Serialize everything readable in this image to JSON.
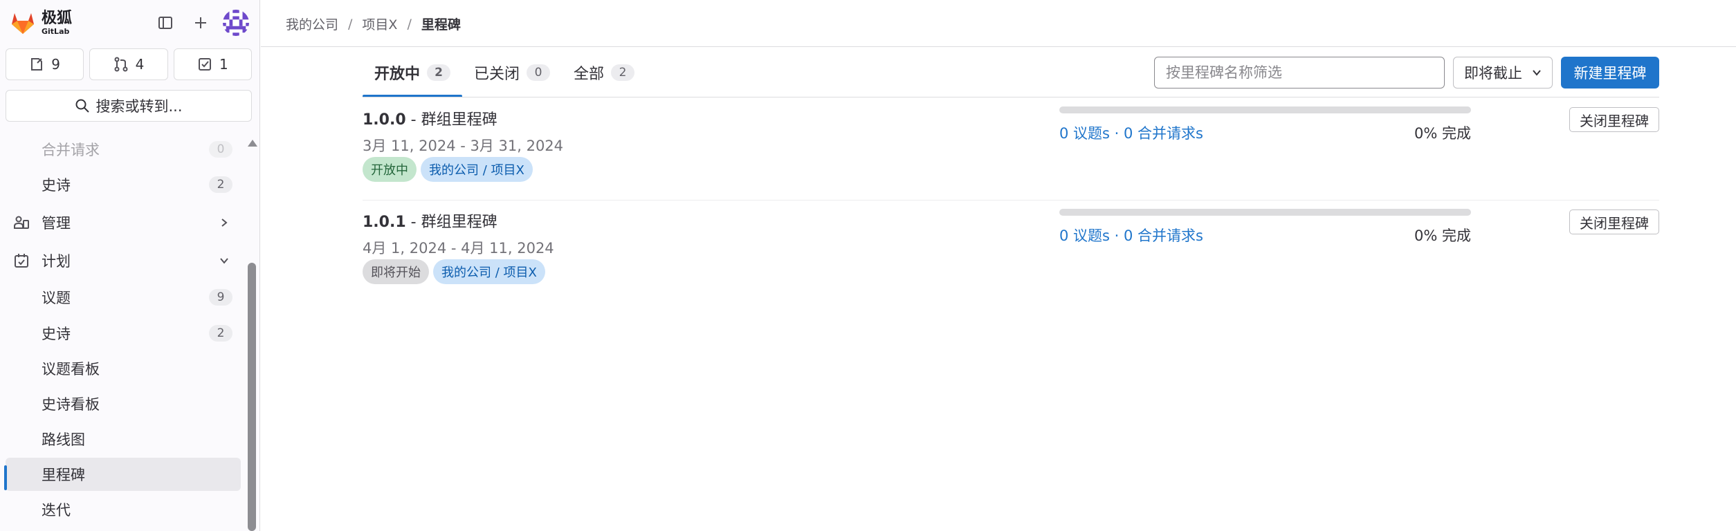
{
  "brand": {
    "name": "极狐",
    "sub": "GitLab"
  },
  "counters": [
    {
      "icon": "issues-icon",
      "value": "9"
    },
    {
      "icon": "merge-request-icon",
      "value": "4"
    },
    {
      "icon": "todo-icon",
      "value": "1"
    }
  ],
  "search": {
    "label": "搜索或转到..."
  },
  "sidebar": {
    "items": [
      {
        "label": "合并请求",
        "count": "0"
      },
      {
        "label": "史诗",
        "count": "2"
      },
      {
        "label": "管理"
      },
      {
        "label": "计划"
      },
      {
        "label": "议题",
        "count": "9"
      },
      {
        "label": "史诗",
        "count": "2"
      },
      {
        "label": "议题看板"
      },
      {
        "label": "史诗看板"
      },
      {
        "label": "路线图"
      },
      {
        "label": "里程碑"
      },
      {
        "label": "迭代"
      }
    ]
  },
  "breadcrumb": {
    "items": [
      "我的公司",
      "项目X",
      "里程碑"
    ],
    "separator": "/"
  },
  "tabs": [
    {
      "label": "开放中",
      "count": "2"
    },
    {
      "label": "已关闭",
      "count": "0"
    },
    {
      "label": "全部",
      "count": "2"
    }
  ],
  "filter": {
    "placeholder": "按里程碑名称筛选"
  },
  "sort": {
    "label": "即将截止"
  },
  "new_button": {
    "label": "新建里程碑"
  },
  "milestones": [
    {
      "version": "1.0.0",
      "name": " - 群组里程碑",
      "dates": "3月 11, 2024 - 3月 31, 2024",
      "status": "开放中",
      "group": "我的公司 / 项目X",
      "links": "0 议题s · 0 合并请求s",
      "percent": "0% 完成",
      "progress": 0,
      "close_label": "关闭里程碑"
    },
    {
      "version": "1.0.1",
      "name": " - 群组里程碑",
      "dates": "4月 1, 2024 - 4月 11, 2024",
      "status": "即将开始",
      "group": "我的公司 / 项目X",
      "links": "0 议题s · 0 合并请求s",
      "percent": "0% 完成",
      "progress": 0,
      "close_label": "关闭里程碑"
    }
  ],
  "colors": {
    "accent": "#1f75cb",
    "sidebar_bg": "#fbfafd",
    "open_badge": "#c3e6cd",
    "group_badge": "#cbe2f9"
  }
}
